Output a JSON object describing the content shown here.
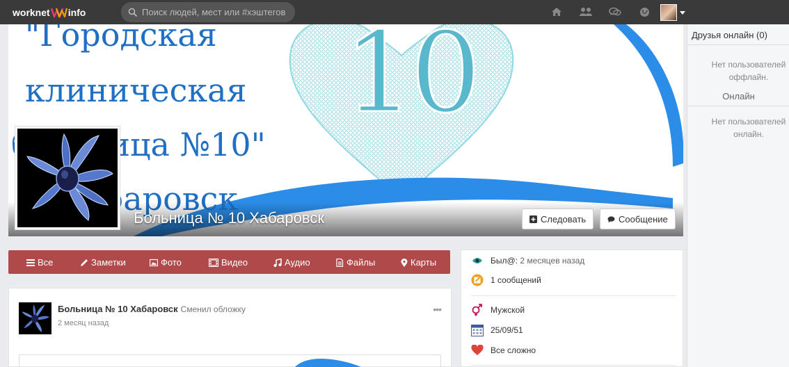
{
  "header": {
    "logo_left": "worknet",
    "logo_right": "info",
    "search_placeholder": "Поиск людей, мест или #хэштегов",
    "icons": [
      "home-icon",
      "users-icon",
      "messages-icon",
      "globe-icon"
    ]
  },
  "cover": {
    "lines": [
      "\"Городская",
      "клиническая",
      "больница №10\"",
      "г. Хабаровск"
    ],
    "number": "10",
    "page_title": "Больница № 10 Хабаровск",
    "follow_label": "Следовать",
    "message_label": "Сообщение"
  },
  "tabs": [
    {
      "label": "Все",
      "icon": "list-icon"
    },
    {
      "label": "Заметки",
      "icon": "pencil-icon"
    },
    {
      "label": "Фото",
      "icon": "photo-icon"
    },
    {
      "label": "Видео",
      "icon": "film-icon"
    },
    {
      "label": "Аудио",
      "icon": "music-icon"
    },
    {
      "label": "Файлы",
      "icon": "file-icon"
    },
    {
      "label": "Карты",
      "icon": "map-marker-icon"
    }
  ],
  "post": {
    "author": "Больница № 10 Хабаровск",
    "action": "Сменил обложку",
    "time": "2 месяц назад",
    "more": "•••"
  },
  "info": {
    "last_seen_label": "Был@:",
    "last_seen_value": "2 месяцев назад",
    "messages": "1 сообщений",
    "gender": "Мужской",
    "birthday": "25/09/51",
    "relationship": "Все сложно"
  },
  "sidebar": {
    "friends_online": "Друзья онлайн (0)",
    "no_offline": "Нет пользователей оффлайн.",
    "online_heading": "Онлайн",
    "no_online": "Нет пользователей онлайн."
  },
  "colors": {
    "topbar": "#3a3a3a",
    "tabs_bar": "#b04a4a",
    "cover_text": "#1f6fc4",
    "heart": "#6cc8d8",
    "swoosh": "#2b8de8"
  }
}
